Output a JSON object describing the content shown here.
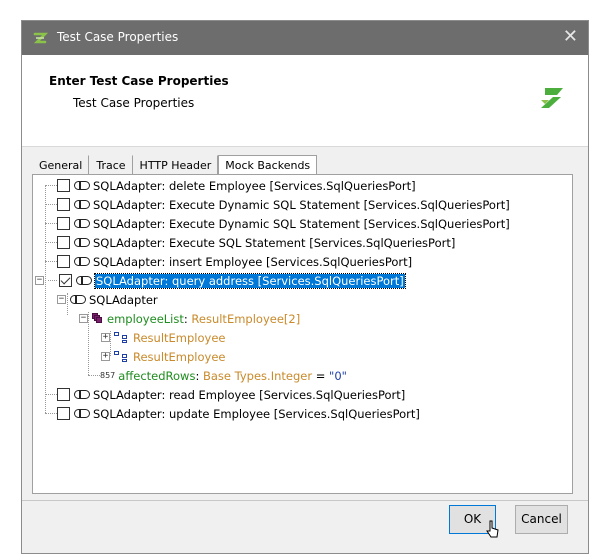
{
  "window": {
    "title": "Test Case Properties",
    "close_glyph": "✕"
  },
  "header": {
    "title": "Enter Test Case Properties",
    "subtitle": "Test Case Properties"
  },
  "tabs": [
    {
      "label": "General"
    },
    {
      "label": "Trace"
    },
    {
      "label": "HTTP Header"
    },
    {
      "label": "Mock Backends",
      "active": true
    }
  ],
  "tree": {
    "items": [
      {
        "label": "SQLAdapter: delete Employee [Services.SqlQueriesPort]",
        "checked": false
      },
      {
        "label": "SQLAdapter: Execute Dynamic SQL Statement [Services.SqlQueriesPort]",
        "checked": false
      },
      {
        "label": "SQLAdapter: Execute Dynamic SQL Statement [Services.SqlQueriesPort]",
        "checked": false
      },
      {
        "label": "SQLAdapter: Execute SQL Statement [Services.SqlQueriesPort]",
        "checked": false
      },
      {
        "label": "SQLAdapter: insert Employee [Services.SqlQueriesPort]",
        "checked": false
      },
      {
        "label": "SQLAdapter: query address [Services.SqlQueriesPort]",
        "checked": true,
        "selected": true
      }
    ],
    "child": {
      "label": "SQLAdapter",
      "employee_list": {
        "name": "employeeList",
        "sep": ": ",
        "type": "ResultEmployee[2]"
      },
      "result_items": [
        "ResultEmployee",
        "ResultEmployee"
      ],
      "affected_rows": {
        "name": "affectedRows",
        "sep": ": ",
        "type": "Base Types.Integer",
        "eq": " = ",
        "value": "\"0\"",
        "icon_text": "857"
      }
    },
    "items_after": [
      {
        "label": "SQLAdapter: read Employee [Services.SqlQueriesPort]",
        "checked": false
      },
      {
        "label": "SQLAdapter: update Employee [Services.SqlQueriesPort]",
        "checked": false
      }
    ]
  },
  "buttons": {
    "ok": "OK",
    "cancel": "Cancel"
  },
  "colors": {
    "titlebar": "#6d6d6d",
    "selection": "#0078d7",
    "logo": "#4caf3d"
  },
  "icons": {
    "app": "app-logo-icon",
    "header_logo": "brand-logo-icon",
    "adapter": "adapter-pill-icon",
    "list": "stack-list-icon",
    "object": "object-struct-icon",
    "integer": "integer-type-icon"
  }
}
